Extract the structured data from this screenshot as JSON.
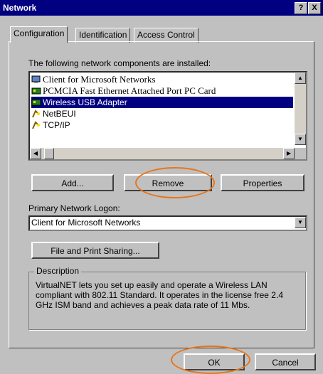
{
  "window": {
    "title": "Network",
    "help_btn": "?",
    "close_btn": "X"
  },
  "tabs": [
    {
      "label": "Configuration"
    },
    {
      "label": "Identification"
    },
    {
      "label": "Access Control"
    }
  ],
  "components": {
    "heading": "The following network components are installed:",
    "items": [
      {
        "label": "Client for Microsoft Networks",
        "icon": "client-icon"
      },
      {
        "label": "PCMCIA Fast Ethernet Attached Port PC Card",
        "icon": "adapter-icon"
      },
      {
        "label": "Wireless USB Adapter",
        "icon": "adapter-icon",
        "selected": true
      },
      {
        "label": "NetBEUI",
        "icon": "protocol-icon"
      },
      {
        "label": "TCP/IP",
        "icon": "protocol-icon"
      }
    ]
  },
  "buttons": {
    "add": "Add...",
    "remove": "Remove",
    "properties": "Properties",
    "file_print": "File and Print Sharing...",
    "ok": "OK",
    "cancel": "Cancel"
  },
  "logon": {
    "label": "Primary Network Logon:",
    "value": "Client for Microsoft Networks"
  },
  "description": {
    "label": "Description",
    "text": "VirtualNET lets you set up easily and operate a Wireless LAN compliant with 802.11 Standard. It operates in the license free 2.4 GHz ISM band and achieves a peak data rate of 11 Mbs."
  },
  "colors": {
    "highlight": "#e8751a",
    "selection": "#000080"
  }
}
